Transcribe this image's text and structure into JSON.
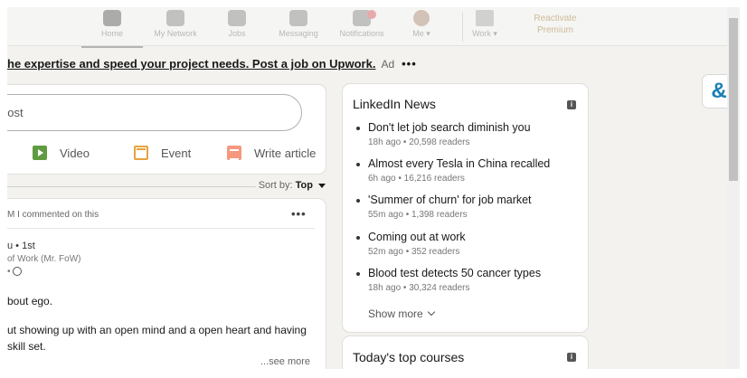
{
  "nav": {
    "items": [
      {
        "label": "Home"
      },
      {
        "label": "My Network"
      },
      {
        "label": "Jobs"
      },
      {
        "label": "Messaging"
      },
      {
        "label": "Notifications"
      },
      {
        "label": "Me ▾"
      },
      {
        "label": "Work ▾"
      }
    ],
    "premium": "Reactivate Premium"
  },
  "ad": {
    "text": "he expertise and speed your project needs. Post a job on Upwork.",
    "tag": "Ad",
    "more": "•••"
  },
  "composer": {
    "placeholder": "post",
    "actions": [
      {
        "label": "Video",
        "icon": "video-icon",
        "color": "#5f9b41"
      },
      {
        "label": "Event",
        "icon": "calendar-icon",
        "color": "#e7a33e"
      },
      {
        "label": "Write article",
        "icon": "article-icon",
        "color": "#f5987e"
      }
    ]
  },
  "sort": {
    "label": "Sort by:",
    "value": "Top"
  },
  "post": {
    "activity": "M I commented on this",
    "menu": "•••",
    "author_degree": "u • 1st",
    "author_headline": "of Work (Mr. FoW)",
    "time_visibility": "•",
    "line1": "bout ego.",
    "line2": "ut showing up with an open mind and a open heart and having",
    "line3": "skill set.",
    "see_more": "...see more"
  },
  "news": {
    "title": "LinkedIn News",
    "items": [
      {
        "title": "Don't let job search diminish you",
        "meta": "18h ago • 20,598 readers"
      },
      {
        "title": "Almost every Tesla in China recalled",
        "meta": "6h ago • 16,216 readers"
      },
      {
        "title": "'Summer of churn' for job market",
        "meta": "55m ago • 1,398 readers"
      },
      {
        "title": "Coming out at work",
        "meta": "52m ago • 352 readers"
      },
      {
        "title": "Blood test detects 50 cancer types",
        "meta": "18h ago • 30,324 readers"
      }
    ],
    "show_more": "Show more"
  },
  "courses": {
    "title": "Today's top courses"
  },
  "side_logo": "&",
  "colors": {
    "accent": "#0a66c2",
    "premium": "#915907",
    "notification": "#cc1016"
  }
}
